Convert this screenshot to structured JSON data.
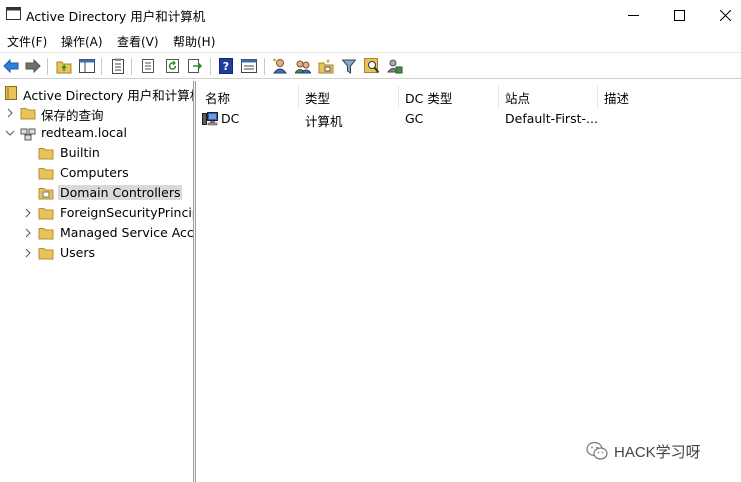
{
  "window": {
    "title": "Active Directory 用户和计算机",
    "minimize_icon": "minimize-icon",
    "maximize_icon": "maximize-icon",
    "close_icon": "close-icon"
  },
  "menu": {
    "items": [
      "文件(F)",
      "操作(A)",
      "查看(V)",
      "帮助(H)"
    ]
  },
  "toolbar": {
    "icons": [
      "back-arrow-icon",
      "forward-arrow-icon",
      "up-folder-icon",
      "show-hide-tree-icon",
      "properties-icon",
      "list-icon",
      "refresh-icon",
      "export-icon",
      "help-icon",
      "console-icon",
      "new-user-icon",
      "new-group-icon",
      "new-ou-icon",
      "filter-icon",
      "find-icon",
      "delegate-icon"
    ]
  },
  "tree": {
    "root": "Active Directory 用户和计算机",
    "saved_queries": "保存的查询",
    "domain": "redteam.local",
    "children": [
      "Builtin",
      "Computers",
      "Domain Controllers",
      "ForeignSecurityPrincipa",
      "Managed Service Acco",
      "Users"
    ],
    "selected": "Domain Controllers"
  },
  "list": {
    "columns": [
      "名称",
      "类型",
      "DC 类型",
      "站点",
      "描述"
    ],
    "rows": [
      {
        "name": "DC",
        "type": "计算机",
        "dc_type": "GC",
        "site": "Default-First-...",
        "description": ""
      }
    ]
  },
  "watermark": {
    "text": "HACK学习呀"
  },
  "colors": {
    "folder": "#E8C25A",
    "selection": "#D9D9D9",
    "border": "#A0A0A0"
  }
}
